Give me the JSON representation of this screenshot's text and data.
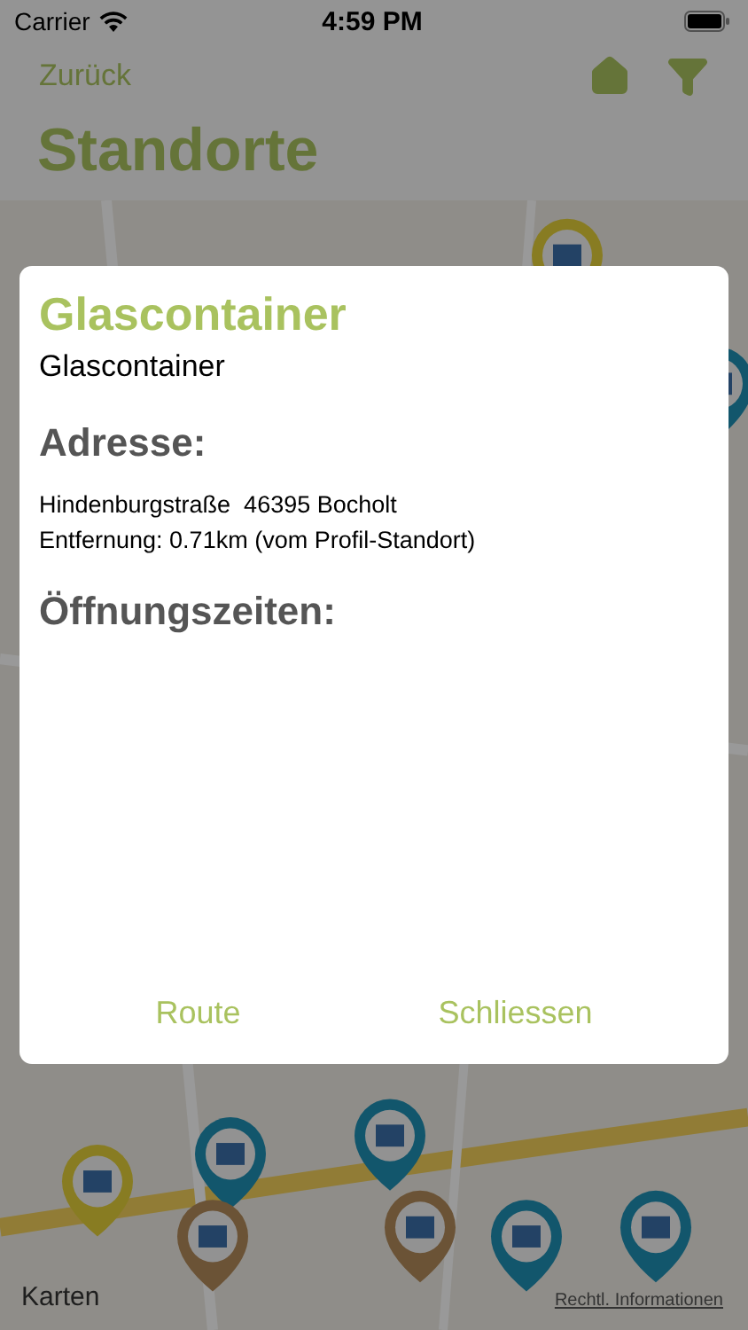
{
  "status_bar": {
    "carrier": "Carrier",
    "time": "4:59 PM"
  },
  "nav": {
    "back": "Zurück",
    "title": "Standorte"
  },
  "map": {
    "kind": "picture",
    "attribution": "Karten",
    "legal_link": "Rechtl. Informationen"
  },
  "dialog": {
    "title": "Glascontainer",
    "subtitle": "Glascontainer",
    "address_heading": "Adresse:",
    "address": "Hindenburgstraße  46395 Bocholt",
    "distance": "Entfernung: 0.71km (vom Profil-Standort)",
    "hours_heading": "Öffnungszeiten:",
    "buttons": [
      "Route",
      "Schliessen"
    ]
  }
}
